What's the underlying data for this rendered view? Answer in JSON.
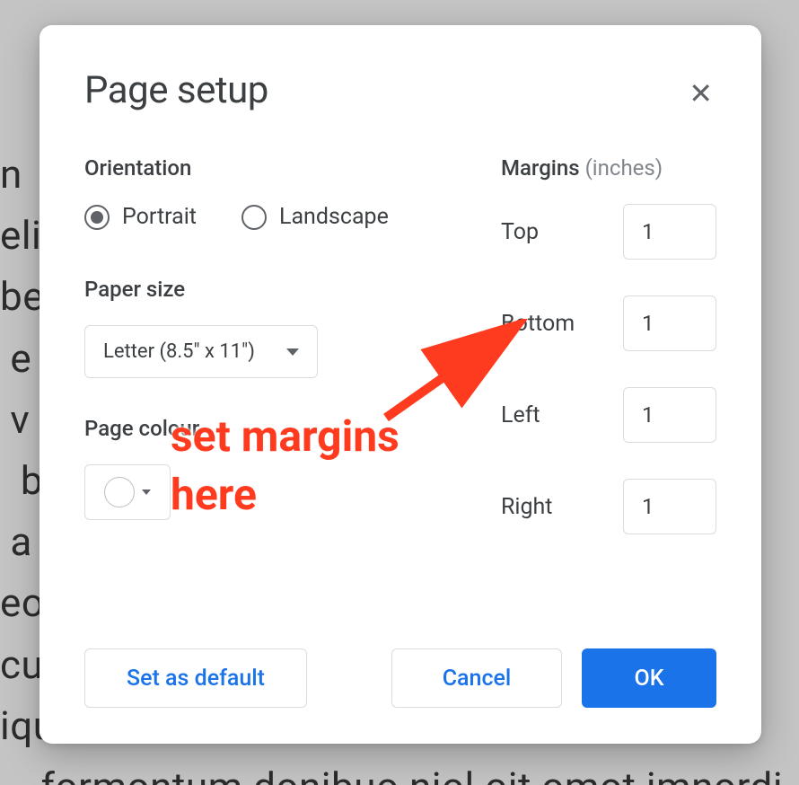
{
  "dialog": {
    "title": "Page setup",
    "orientation": {
      "label": "Orientation",
      "portrait": "Portrait",
      "landscape": "Landscape",
      "selected": "portrait"
    },
    "paperSize": {
      "label": "Paper size",
      "value": "Letter (8.5\" x 11\")"
    },
    "pageColour": {
      "label": "Page colour"
    },
    "margins": {
      "label": "Margins",
      "unit": "(inches)",
      "top": {
        "label": "Top",
        "value": "1"
      },
      "bottom": {
        "label": "Bottom",
        "value": "1"
      },
      "left": {
        "label": "Left",
        "value": "1"
      },
      "right": {
        "label": "Right",
        "value": "1"
      }
    },
    "buttons": {
      "setDefault": "Set as default",
      "cancel": "Cancel",
      "ok": "OK"
    }
  },
  "annotation": {
    "line1": "set margins",
    "line2": "here"
  },
  "backgroundText": "n                                                               g\neli                                                             n a\nbe                                                              dic\n e                                                               a\n v                                                               lig\n  b                                                              ms\n a                                                               eu\neo                                                               oul\ncu                                                               lee\niqu                                                              ms\n    formontum donibuo niol oit omot imnordi"
}
